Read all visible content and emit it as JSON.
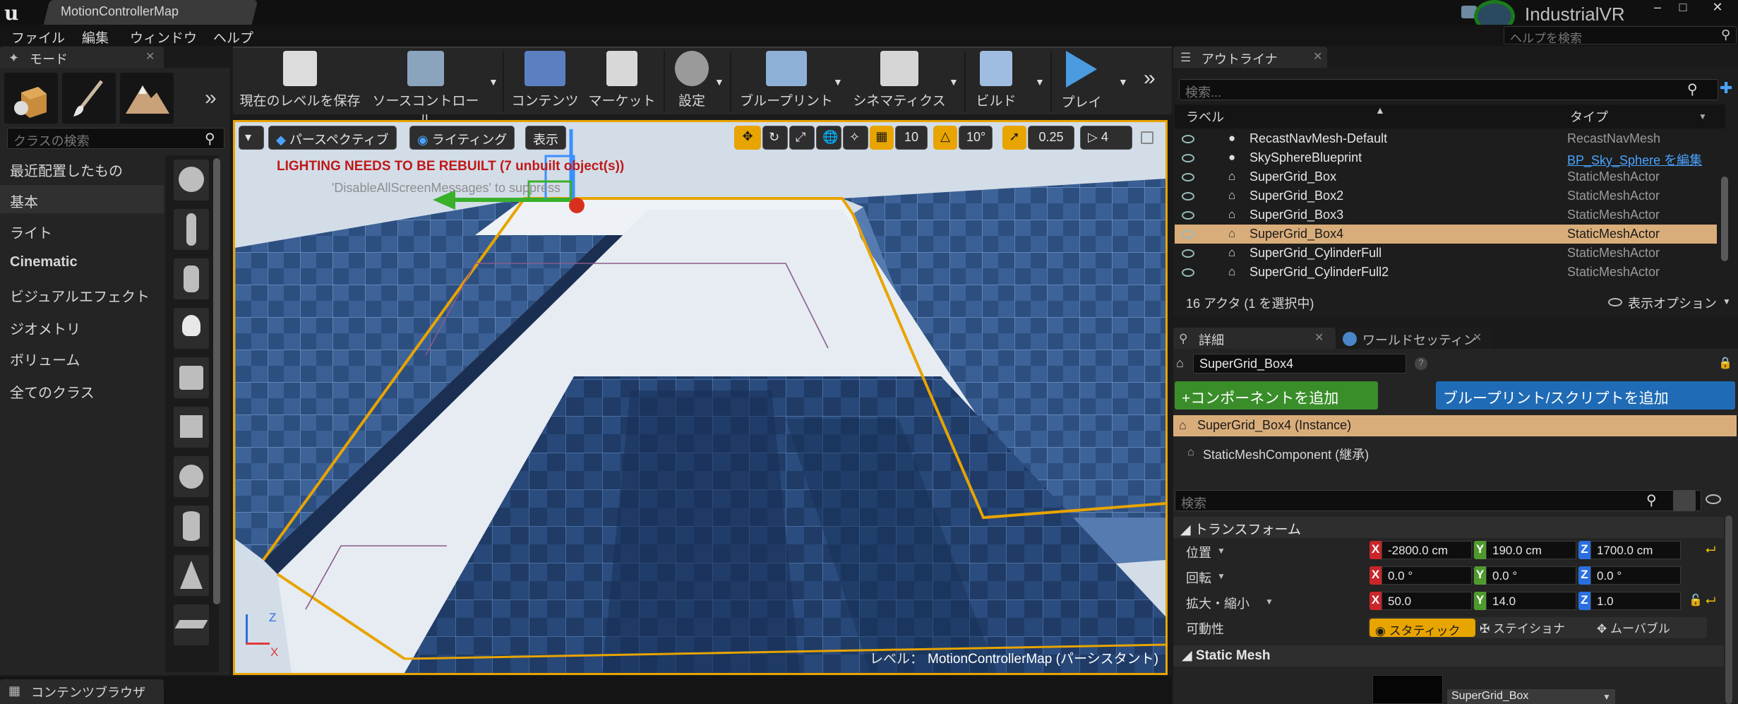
{
  "window": {
    "tab_title": "MotionControllerMap",
    "project_name": "IndustrialVR",
    "minimize": "–",
    "maximize": "□",
    "close": "✕",
    "logo": "u"
  },
  "menu": {
    "items": [
      "ファイル",
      "編集",
      "ウィンドウ",
      "ヘルプ"
    ],
    "help_search_placeholder": "ヘルプを検索"
  },
  "modes": {
    "tab_label": "モード",
    "search_placeholder": "クラスの検索",
    "categories": [
      "最近配置したもの",
      "基本",
      "ライト",
      "Cinematic",
      "ビジュアルエフェクト",
      "ジオメトリ",
      "ボリューム",
      "全てのクラス"
    ],
    "selected_category": "基本"
  },
  "toolbar": {
    "buttons": [
      "現在のレベルを保存",
      "ソースコントロール",
      "コンテンツ",
      "マーケット",
      "設定",
      "ブループリント",
      "シネマティクス",
      "ビルド",
      "プレイ"
    ]
  },
  "viewport": {
    "perspective": "パースペクティブ",
    "lighting": "ライティング",
    "show": "表示",
    "grid_snap": "10",
    "rotation_snap": "10°",
    "scale_snap": "0.25",
    "camera_speed": "4",
    "warning": "LIGHTING NEEDS TO BE REBUILT (7 unbuilt object(s))",
    "suppress": "'DisableAllScreenMessages' to suppress",
    "level_label": "レベル：",
    "level_name": "MotionControllerMap (パーシスタント)",
    "axis_z": "Z",
    "axis_x": "X"
  },
  "outliner": {
    "tab_label": "アウトライナ",
    "search_placeholder": "検索...",
    "col_label": "ラベル",
    "col_type": "タイプ",
    "rows": [
      {
        "label": "RecastNavMesh-Default",
        "type": "RecastNavMesh"
      },
      {
        "label": "SkySphereBlueprint",
        "type": "BP_Sky_Sphere を編集"
      },
      {
        "label": "SuperGrid_Box",
        "type": "StaticMeshActor"
      },
      {
        "label": "SuperGrid_Box2",
        "type": "StaticMeshActor"
      },
      {
        "label": "SuperGrid_Box3",
        "type": "StaticMeshActor"
      },
      {
        "label": "SuperGrid_Box4",
        "type": "StaticMeshActor"
      },
      {
        "label": "SuperGrid_CylinderFull",
        "type": "StaticMeshActor"
      },
      {
        "label": "SuperGrid_CylinderFull2",
        "type": "StaticMeshActor"
      }
    ],
    "selected_row": "SuperGrid_Box4",
    "actor_count": "16 アクタ (1 を選択中)",
    "view_options": "表示オプション"
  },
  "details": {
    "tab_label": "詳細",
    "world_tab_label": "ワールドセッティン",
    "name": "SuperGrid_Box4",
    "add_component": "+コンポーネントを追加",
    "add_blueprint": "ブループリント/スクリプトを追加",
    "instance": "SuperGrid_Box4 (Instance)",
    "component": "StaticMeshComponent (継承)",
    "search_placeholder": "検索",
    "transform_header": "トランスフォーム",
    "location_label": "位置",
    "rotation_label": "回転",
    "scale_label": "拡大・縮小",
    "mobility_label": "可動性",
    "location": {
      "x": "-2800.0 cm",
      "y": "190.0 cm",
      "z": "1700.0 cm"
    },
    "rotation": {
      "x": "0.0 °",
      "y": "0.0 °",
      "z": "0.0 °"
    },
    "scale": {
      "x": "50.0",
      "y": "14.0",
      "z": "1.0"
    },
    "mobility": {
      "static": "スタティック",
      "stationary": "ステイショナ",
      "movable": "ムーバブル"
    },
    "static_mesh_header": "Static Mesh",
    "static_mesh_value": "SuperGrid_Box"
  },
  "content_browser": {
    "tab_label": "コンテンツブラウザ"
  },
  "colors": {
    "accent_orange": "#e8a400",
    "selection": "#d9ad7a",
    "add_component_green": "#3a8e2a",
    "add_blueprint_blue": "#1f6bb5",
    "warning_red": "#c01818"
  }
}
